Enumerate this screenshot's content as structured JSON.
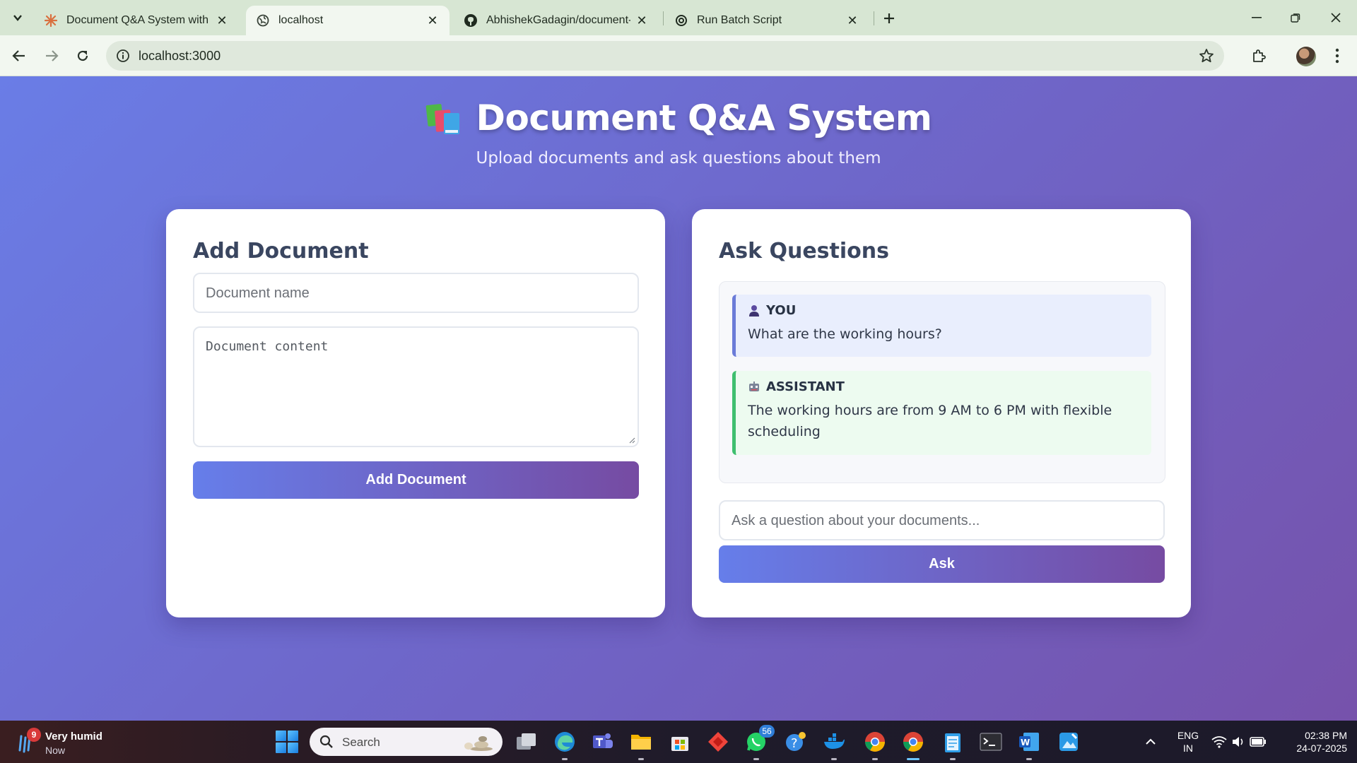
{
  "browser": {
    "tabs": [
      {
        "title": "Document Q&A System with Qo",
        "icon": "claude-icon",
        "active": false
      },
      {
        "title": "localhost",
        "icon": "globe-icon",
        "active": true
      },
      {
        "title": "AbhishekGadagin/document-qa",
        "icon": "github-icon",
        "active": false
      },
      {
        "title": "Run Batch Script",
        "icon": "openai-icon",
        "active": false
      }
    ],
    "url": "localhost:3000"
  },
  "page": {
    "title": "Document Q&A System",
    "title_icon": "books-icon",
    "subtitle": "Upload documents and ask questions about them",
    "add_document": {
      "heading": "Add Document",
      "name_placeholder": "Document name",
      "content_placeholder": "Document content",
      "button": "Add Document"
    },
    "ask_questions": {
      "heading": "Ask Questions",
      "messages": [
        {
          "role": "YOU",
          "icon": "user-icon",
          "text": "What are the working hours?"
        },
        {
          "role": "ASSISTANT",
          "icon": "robot-icon",
          "text": "The working hours are from 9 AM to 6 PM with flexible scheduling"
        }
      ],
      "question_placeholder": "Ask a question about your documents...",
      "button": "Ask"
    }
  },
  "taskbar": {
    "weather": {
      "title": "Very humid",
      "subtitle": "Now",
      "badge": "9"
    },
    "search_label": "Search",
    "whatsapp_count": "56",
    "language": {
      "line1": "ENG",
      "line2": "IN"
    },
    "time": "02:38 PM",
    "date": "24-07-2025"
  }
}
